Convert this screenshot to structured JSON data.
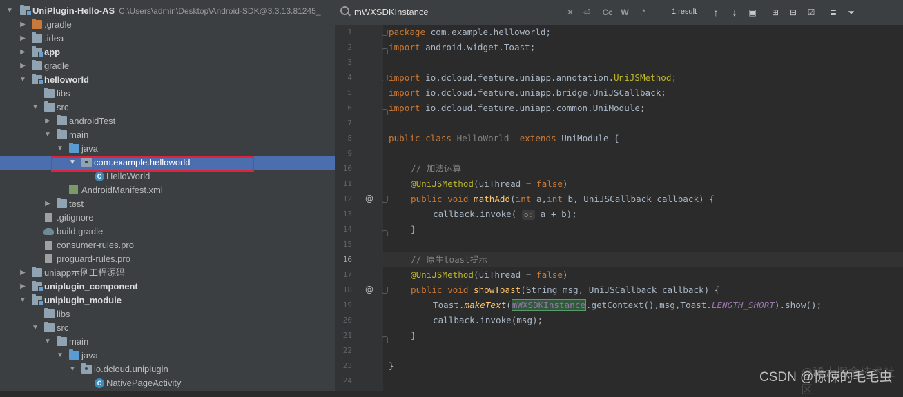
{
  "project_tree": {
    "root": {
      "name": "UniPlugin-Hello-AS",
      "path": "C:\\Users\\admin\\Desktop\\Android-SDK@3.3.13.81245_"
    },
    "items": [
      {
        "label": ".gradle"
      },
      {
        "label": ".idea"
      },
      {
        "label": "app"
      },
      {
        "label": "gradle"
      },
      {
        "label": "helloworld"
      },
      {
        "label": "libs"
      },
      {
        "label": "src"
      },
      {
        "label": "androidTest"
      },
      {
        "label": "main"
      },
      {
        "label": "java"
      },
      {
        "label": "com.example.helloworld"
      },
      {
        "label": "HelloWorld"
      },
      {
        "label": "AndroidManifest.xml"
      },
      {
        "label": "test"
      },
      {
        "label": ".gitignore"
      },
      {
        "label": "build.gradle"
      },
      {
        "label": "consumer-rules.pro"
      },
      {
        "label": "proguard-rules.pro"
      },
      {
        "label": "uniapp示例工程源码"
      },
      {
        "label": "uniplugin_component"
      },
      {
        "label": "uniplugin_module"
      },
      {
        "label": "libs"
      },
      {
        "label": "src"
      },
      {
        "label": "main"
      },
      {
        "label": "java"
      },
      {
        "label": "io.dcloud.uniplugin"
      },
      {
        "label": "NativePageActivity"
      }
    ]
  },
  "search": {
    "query": "mWXSDKInstance",
    "result_count": "1 result",
    "case_label": "Cc",
    "word_label": "W",
    "regex_label": ".*"
  },
  "editor": {
    "line_numbers": [
      "1",
      "2",
      "3",
      "4",
      "5",
      "6",
      "7",
      "8",
      "9",
      "10",
      "11",
      "12",
      "13",
      "14",
      "15",
      "16",
      "17",
      "18",
      "19",
      "20",
      "21",
      "22",
      "23",
      "24"
    ],
    "current_line": "16",
    "code": {
      "l1_kw": "package",
      "l1_rest": " com.example.helloworld;",
      "l2_kw": "import",
      "l2_rest": " android.widget.Toast;",
      "l4_kw": "import",
      "l4_rest": " io.dcloud.feature.uniapp.annotation.",
      "l4_ann": "UniJSMethod",
      "l4_end": ";",
      "l5_kw": "import",
      "l5_rest": " io.dcloud.feature.uniapp.bridge.UniJSCallback;",
      "l6_kw": "import",
      "l6_rest": " io.dcloud.feature.uniapp.common.UniModule;",
      "l8_kw1": "public class",
      "l8_cls": " HelloWorld ",
      "l8_kw2": " extends",
      "l8_rest": " UniModule {",
      "l10_cm": "// 加法运算",
      "l11_ann": "@UniJSMethod",
      "l11_rest": "(uiThread = ",
      "l11_kw": "false",
      "l11_end": ")",
      "l12_kw": "public void",
      "l12_fn": " mathAdd",
      "l12_p1": "(",
      "l12_kw2": "int",
      "l12_p2": " a,",
      "l12_kw3": "int",
      "l12_p3": " b, UniJSCallback callback) {",
      "l13_a": "callback.invoke( ",
      "l13_hint": "o:",
      "l13_b": " a + b);",
      "l14": "}",
      "l16_cm": "// 原生toast提示",
      "l17_ann": "@UniJSMethod",
      "l17_rest": "(uiThread = ",
      "l17_kw": "false",
      "l17_end": ")",
      "l18_kw": "public void",
      "l18_fn": " showToast",
      "l18_rest": "(String msg, UniJSCallback callback) {",
      "l19_a": "Toast.",
      "l19_it": "makeText",
      "l19_p": "(",
      "l19_hl": "mWXSDKInstance",
      "l19_b": ".getContext(),msg,Toast.",
      "l19_cst": "LENGTH_SHORT",
      "l19_c": ").show();",
      "l20": "callback.invoke(msg);",
      "l21": "}",
      "l23": "}"
    },
    "gutter_marks": [
      "@",
      "@"
    ]
  },
  "watermark": {
    "text": "CSDN @惊悚的毛毛虫",
    "text2": "@稀土掘金技术社区"
  },
  "colors": {
    "tree_bg": "#3c3f41",
    "selection": "#4b6eaf",
    "editor_bg": "#2b2b2b",
    "keyword": "#cc7832",
    "annotation": "#bbb529",
    "function": "#ffc66d",
    "highlight_box": "#e0233a"
  }
}
